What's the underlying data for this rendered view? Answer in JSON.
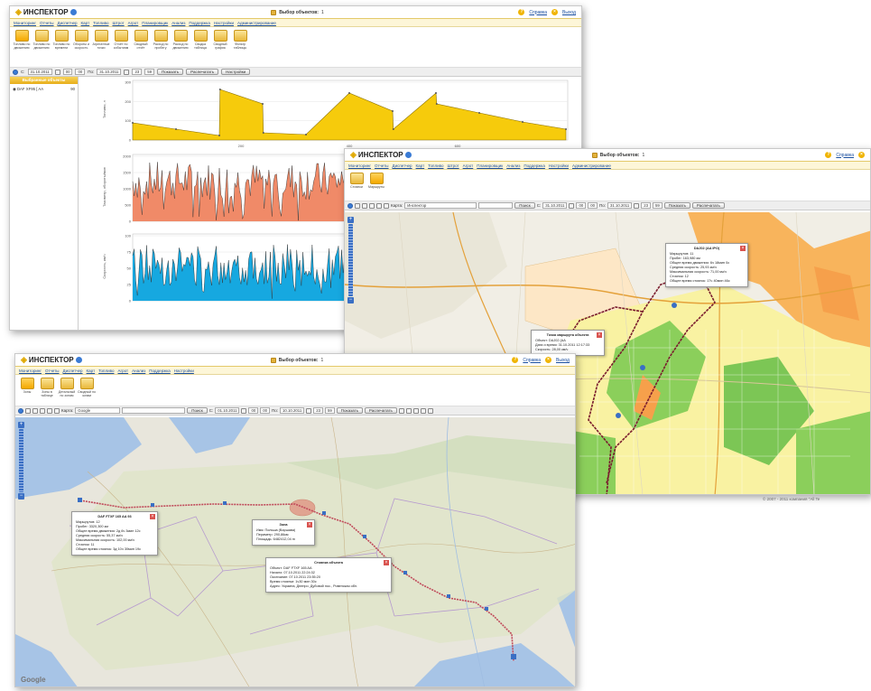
{
  "app": {
    "logo_text": "ИНСПЕКТОР",
    "help_label": "Справка",
    "exit_label": "Выход"
  },
  "win1": {
    "selection_label": "Выбор объектов:",
    "selection_count": "1",
    "menu": [
      "Мониторинг",
      "Отчеты",
      "Диспетчер",
      "Карт",
      "Топливо",
      "Штрот",
      "Агрот",
      "Планировщик",
      "Анализ",
      "Поддержка",
      "Настройки",
      "Администрирование"
    ],
    "tools": [
      {
        "label": "Топливо по движению",
        "icon": "fuel-chart-icon",
        "active": true
      },
      {
        "label": "Топливо по движению",
        "icon": "fuel-move-icon",
        "active": false
      },
      {
        "label": "Топливо по времени",
        "icon": "fuel-time-icon",
        "active": false
      },
      {
        "label": "Обороты и скорость",
        "icon": "rpm-speed-icon",
        "active": false
      },
      {
        "label": "Агрегатные точки",
        "icon": "aggregate-points-icon",
        "active": false
      },
      {
        "label": "Отчёт по событиям",
        "icon": "events-report-icon",
        "active": false
      },
      {
        "label": "Сводный отчёт",
        "icon": "summary-report-icon",
        "active": false
      },
      {
        "label": "Расход по пробегу",
        "icon": "mileage-consumption-icon",
        "active": false
      },
      {
        "label": "Расход по движению",
        "icon": "move-consumption-icon",
        "active": false
      },
      {
        "label": "Сводка таблица",
        "icon": "summary-table-icon",
        "active": false
      },
      {
        "label": "Сводный график",
        "icon": "summary-graph-icon",
        "active": false
      },
      {
        "label": "Фильтр таблицы",
        "icon": "table-filter-icon",
        "active": false
      }
    ],
    "filter": {
      "from_label": "С:",
      "from_date": "31.10.2011",
      "from_hour": "00",
      "from_min": "00",
      "to_label": "По:",
      "to_date": "31.10.2011",
      "to_hour": "23",
      "to_min": "59",
      "show_btn": "Показать",
      "print_btn": "Распечатать",
      "settings_btn": "Настройки"
    },
    "sidebar": {
      "header": "Выбранные объекты",
      "object_name": "DAF XF95 [ AA",
      "object_code": "90"
    }
  },
  "chart_data": [
    {
      "type": "area",
      "ylabel": "Топливо, л",
      "x": [
        0,
        60,
        120,
        121,
        180,
        181,
        240,
        300,
        360,
        361,
        420,
        421,
        480,
        540,
        600
      ],
      "values": [
        95,
        60,
        25,
        280,
        200,
        40,
        30,
        260,
        160,
        60,
        260,
        200,
        150,
        100,
        60
      ],
      "xticks": [
        "200",
        "400",
        "600"
      ],
      "yticks": [
        "0",
        "100",
        "200",
        "300"
      ],
      "ylim": [
        0,
        320
      ],
      "color": "#f6cb0c"
    },
    {
      "type": "area",
      "ylabel": "Тахометр, обороты/мин",
      "yticks": [
        "0",
        "500",
        "1000",
        "1500",
        "2000"
      ],
      "ylim": [
        0,
        2000
      ],
      "color": "#f08a68"
    },
    {
      "type": "area",
      "ylabel": "Скорость, км/ч",
      "yticks": [
        "0",
        "25",
        "50",
        "75",
        "100"
      ],
      "ylim": [
        0,
        100
      ],
      "color": "#16a8e0"
    }
  ],
  "win2": {
    "selection_label": "Выбор объектов:",
    "selection_count": "1",
    "menu": [
      "Мониторинг",
      "Отчеты",
      "Диспетчер",
      "Карт",
      "Топливо",
      "Штрот",
      "Агрот",
      "Планировщик",
      "Анализ",
      "Поддержка",
      "Настройки",
      "Администрирование"
    ],
    "tools": [
      {
        "label": "Стоянки",
        "icon": "parking-icon",
        "active": false
      },
      {
        "label": "Маршруты",
        "icon": "routes-icon",
        "active": true
      }
    ],
    "map_label": "Карта:",
    "map_value": "Инспектор",
    "search_btn": "Поиск",
    "filter": {
      "from_label": "С:",
      "from_date": "31.10.2011",
      "from_hour": "00",
      "from_min": "00",
      "to_label": "По:",
      "to_date": "31.10.2011",
      "to_hour": "23",
      "to_min": "59",
      "show_btn": "Показать",
      "print_btn": "Распечатать"
    },
    "popup_main": {
      "title": "DAJ02 (AA",
      "code": "IPO)",
      "lines": [
        "Маршрутов: 11",
        "Пробег: 163,980 км",
        "Общее время движения: 6ч 18мин 0с",
        "Средняя скорость: 25,93 км/ч",
        "Максимальная скорость: 71,00 км/ч",
        "Стоянок: 12",
        "Общее время стоянок: 17ч 40мин 46с"
      ]
    },
    "popup_point": {
      "title": "Точка маршрута объекта",
      "lines": [
        "Объект: DAJ02 (AA",
        "Дата и время: 31.10.2011 12:17:33",
        "Скорость: 28,00 км/ч"
      ]
    },
    "copyright": "© 2007 - 2011 компания \"All Te"
  },
  "win3": {
    "selection_label": "Выбор объектов:",
    "selection_count": "1",
    "menu": [
      "Мониторинг",
      "Отчеты",
      "Диспетчер",
      "Карт",
      "Топливо",
      "Агрот",
      "Анализ",
      "Поддержка",
      "Настройки"
    ],
    "tools": [
      {
        "label": "Зоны",
        "icon": "zones-icon",
        "active": true
      },
      {
        "label": "Зоны в таблице",
        "icon": "zones-table-icon",
        "active": false
      },
      {
        "label": "Детальный по зонам",
        "icon": "zones-detail-icon",
        "active": false
      },
      {
        "label": "Сводный по зонам",
        "icon": "zones-summary-icon",
        "active": false
      }
    ],
    "map_label": "Карта:",
    "map_value": "Google",
    "search_btn": "Поиск",
    "filter": {
      "from_label": "С:",
      "from_date": "01.10.2011",
      "from_hour": "00",
      "from_min": "00",
      "to_label": "По:",
      "to_date": "10.10.2011",
      "to_hour": "23",
      "to_min": "59",
      "show_btn": "Показать",
      "print_btn": "Распечатать"
    },
    "popup_route": {
      "title": "DAF FTXF 165 AA",
      "code": "93",
      "lines": [
        "Маршрутов: 12",
        "Пробег: 3320,300 км",
        "Общее время движения: 2д 6ч 3мин 12с",
        "Средняя скорость: 55,37 км/ч",
        "Максимальная скорость: 102,00 км/ч",
        "Стоянок: 11",
        "Общее время стоянок: 3д 10ч 30мин 19с"
      ]
    },
    "popup_zone": {
      "title": "Зона",
      "lines": [
        "Имя: Польша (Варшава)",
        "Периметр: 290,86км",
        "Площадь: 6482412,04 m"
      ]
    },
    "popup_stop": {
      "title": "Стоянка объекта",
      "lines": [
        "Объект: DAF FTXF 165 AA",
        "Начало: 07.10.2011 22:24:32",
        "Окончание: 07.10.2011 23:55:20",
        "Время стоянки: 1ч30 мин 30с",
        "Адрес: Украина, Днепро, Дубовой пос., Ровенская обл."
      ]
    },
    "google_logo": "Google"
  }
}
